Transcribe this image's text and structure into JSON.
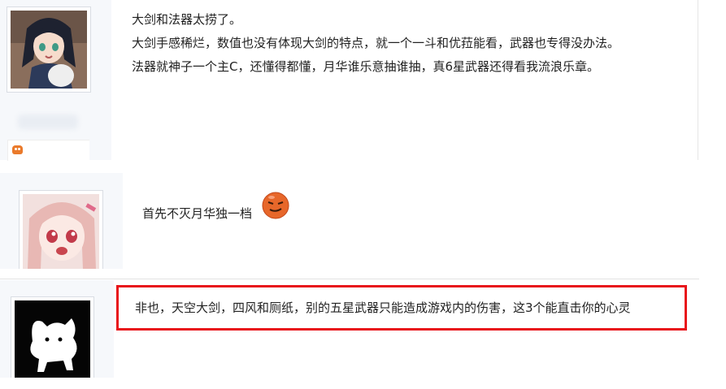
{
  "posts": [
    {
      "lines": [
        "大剑和法器太捞了。",
        "大剑手感稀烂，数值也没有体现大剑的特点，就一个一斗和优菈能看，武器也专得没办法。",
        "法器就神子一个主C，还懂得都懂，月华谁乐意抽谁抽，真6星武器还得看我流浪乐章。"
      ],
      "badge_icon": "game-controller-icon"
    },
    {
      "lines": [
        "首先不灭月华独一档"
      ],
      "emoji_icon": "smug-face-emoji-icon"
    },
    {
      "lines": [
        "非也，天空大剑，四风和厕纸，别的五星武器只能造成游戏内的伤害，这3个能直击你的心灵"
      ],
      "highlight_color": "#e8141b"
    }
  ]
}
